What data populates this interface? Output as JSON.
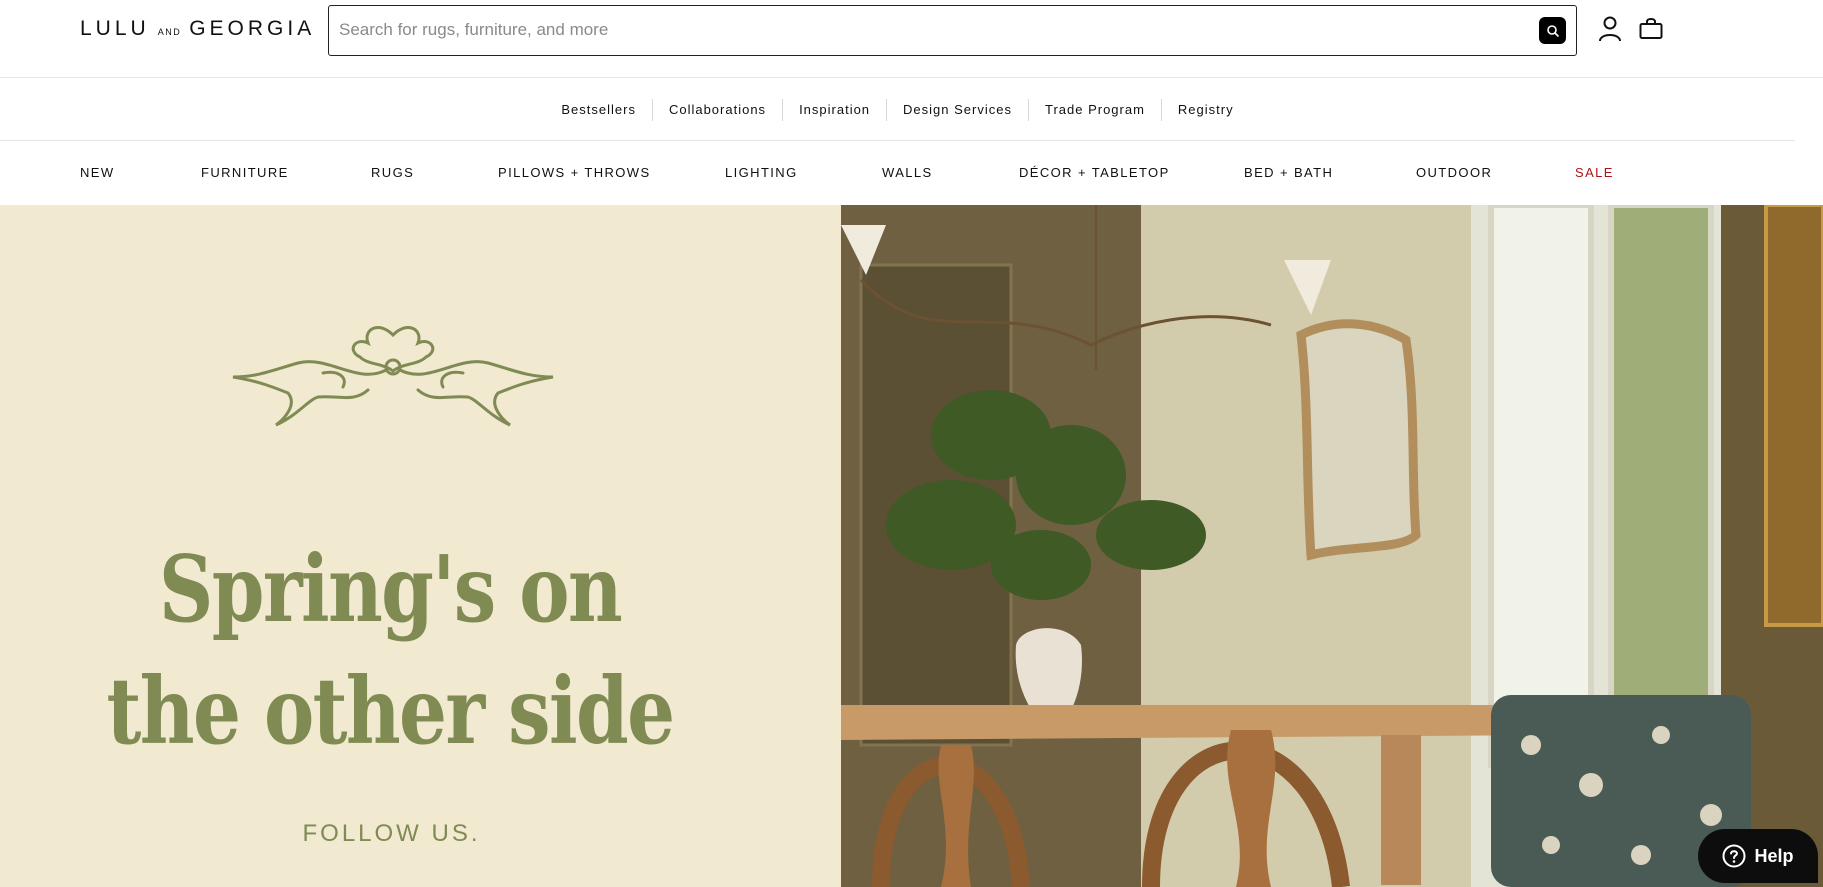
{
  "header": {
    "logo_left": "LULU",
    "logo_and": "AND",
    "logo_right": "GEORGIA",
    "search_placeholder": "Search for rugs, furniture, and more",
    "search_value": ""
  },
  "utility_nav": [
    "Bestsellers",
    "Collaborations",
    "Inspiration",
    "Design Services",
    "Trade Program",
    "Registry"
  ],
  "category_nav": [
    "NEW",
    "FURNITURE",
    "RUGS",
    "PILLOWS + THROWS",
    "LIGHTING",
    "WALLS",
    "DÉCOR + TABLETOP",
    "BED + BATH",
    "OUTDOOR",
    "SALE"
  ],
  "hero": {
    "headline_line1": "Spring's on",
    "headline_line2": "the other side",
    "cta": "FOLLOW US."
  },
  "help": {
    "label": "Help"
  },
  "colors": {
    "hero_bg": "#f1e9d0",
    "hero_text": "#7f8b53",
    "sale": "#b0121a"
  }
}
